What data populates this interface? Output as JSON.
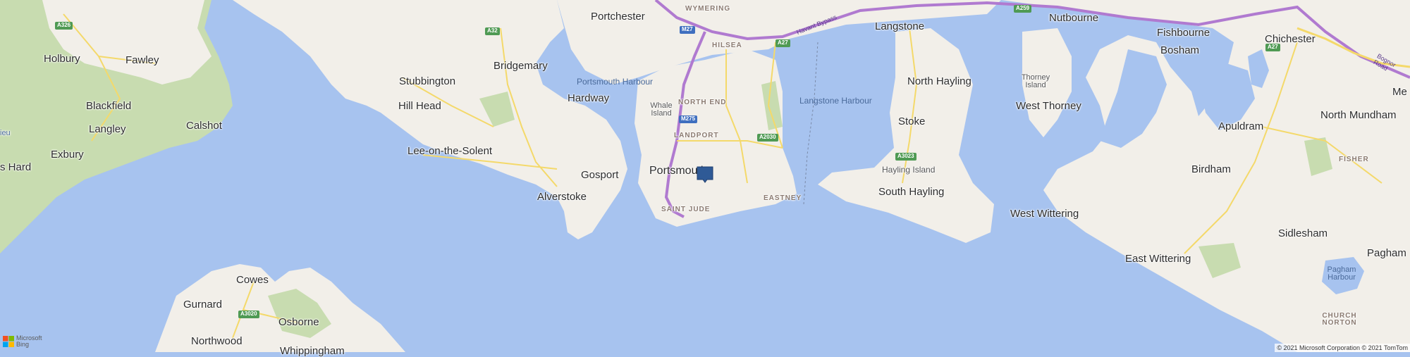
{
  "map": {
    "places": {
      "holbury": "Holbury",
      "fawley": "Fawley",
      "blackfield": "Blackfield",
      "langley": "Langley",
      "calshot": "Calshot",
      "exbury": "Exbury",
      "s_hard": "s Hard",
      "ieu": "ieu",
      "stubbington": "Stubbington",
      "hill_head": "Hill Head",
      "bridgemary": "Bridgemary",
      "hardway": "Hardway",
      "lee_on_the_solent": "Lee-on-the-Solent",
      "gosport": "Gosport",
      "alverstoke": "Alverstoke",
      "portchester": "Portchester",
      "whale_island": "Whale Island",
      "portsmouth": "Portsmouth",
      "langstone": "Langstone",
      "north_hayling": "North Hayling",
      "stoke": "Stoke",
      "hayling_island": "Hayling Island",
      "south_hayling": "South Hayling",
      "nutbourne": "Nutbourne",
      "fishbourne": "Fishbourne",
      "bosham": "Bosham",
      "chichester": "Chichester",
      "thorney_island": "Thorney Island",
      "west_thorney": "West Thorney",
      "apuldram": "Apuldram",
      "north_mundham": "North Mundham",
      "me": "Me",
      "birdham": "Birdham",
      "west_wittering": "West Wittering",
      "east_wittering": "East Wittering",
      "sidlesham": "Sidlesham",
      "pagham": "Pagham",
      "pagham_harbour": "Pagham Harbour",
      "cowes": "Cowes",
      "gurnard": "Gurnard",
      "osborne": "Osborne",
      "northwood": "Northwood",
      "whippingham": "Whippingham"
    },
    "water": {
      "portsmouth_harbour": "Portsmouth Harbour",
      "langstone_harbour": "Langstone Harbour"
    },
    "districts": {
      "wymering": "WYMERING",
      "hilsea": "HILSEA",
      "north_end": "NORTH END",
      "landport": "LANDPORT",
      "saint_jude": "SAINT JUDE",
      "eastney": "EASTNEY",
      "fisher": "FISHER",
      "church_norton": "CHURCH NORTON"
    },
    "roads": {
      "a326": "A326",
      "a32": "A32",
      "m27": "M27",
      "m275": "M275",
      "a27_west": "A27",
      "a27_east": "A27",
      "a2030": "A2030",
      "a3023": "A3023",
      "a259": "A259",
      "a3020": "A3020",
      "havant_bypass": "Havant Bypass",
      "bognor_road": "Bognor Road"
    },
    "attribution": {
      "logo_line1": "Microsoft",
      "logo_line2": "Bing",
      "copyright": "© 2021 Microsoft Corporation © 2021 TomTom"
    },
    "colors": {
      "sea": "#a7c3ef",
      "land": "#f2efe9",
      "forest": "#c8dcb0",
      "motorway": "#b07ad0",
      "road": "#f4d96a",
      "marker": "#2f5a96"
    }
  }
}
